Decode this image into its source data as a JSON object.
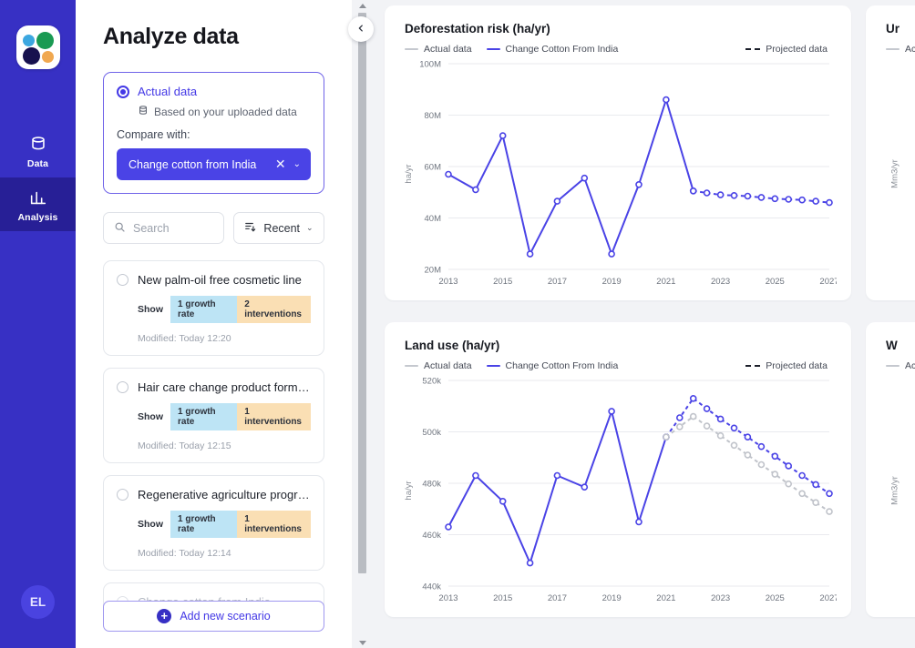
{
  "rail": {
    "logo_name": "app-logo",
    "items": [
      {
        "label": "Data",
        "icon": "database-icon"
      },
      {
        "label": "Analysis",
        "icon": "bar-chart-icon"
      }
    ],
    "avatar_initials": "EL"
  },
  "panel": {
    "title": "Analyze data",
    "source": {
      "radio_label": "Actual data",
      "sub_label": "Based on your uploaded data",
      "compare_label": "Compare with:",
      "pill_label": "Change cotton from India",
      "pill_clear": "✕",
      "pill_caret": "⌄"
    },
    "search_placeholder": "Search",
    "sort_label": "Recent",
    "sort_caret": "⌄",
    "show_label": "Show",
    "scenarios": [
      {
        "name": "New palm-oil free cosmetic line",
        "growth_tag": "1 growth rate",
        "intervention_tag": "2 interventions",
        "modified": "Modified: Today 12:20"
      },
      {
        "name": "Hair care change product formula",
        "growth_tag": "1 growth rate",
        "intervention_tag": "1 interventions",
        "modified": "Modified: Today 12:15"
      },
      {
        "name": "Regenerative agriculture progra...",
        "growth_tag": "1 growth rate",
        "intervention_tag": "1 interventions",
        "modified": "Modified: Today 12:14"
      },
      {
        "name": "Change cotton from India",
        "growth_tag": "",
        "intervention_tag": "",
        "modified": ""
      }
    ],
    "add_button": "Add new scenario",
    "add_icon": "plus-circle-icon"
  },
  "gutter": {
    "collapse_icon": "chevron-left-icon"
  },
  "charts": {
    "legend": {
      "actual": "Actual data",
      "scenario": "Change Cotton From India",
      "projected": "Projected data"
    },
    "partial": [
      {
        "title": "Ur",
        "ylabel": "Mm3/yr"
      },
      {
        "title": "W",
        "ylabel": "Mm3/yr"
      }
    ]
  },
  "chart_data": [
    {
      "type": "line",
      "title": "Deforestation risk (ha/yr)",
      "xlabel": "",
      "ylabel": "ha/yr",
      "ylim": [
        20000000,
        100000000
      ],
      "yticks": [
        20000000,
        40000000,
        60000000,
        80000000,
        100000000
      ],
      "ytick_labels": [
        "20M",
        "40M",
        "60M",
        "80M",
        "100M"
      ],
      "xlim": [
        2013,
        2027
      ],
      "xticks": [
        2013,
        2015,
        2017,
        2019,
        2021,
        2023,
        2025,
        2027
      ],
      "grid": true,
      "legend_position": "top",
      "series": [
        {
          "name": "Change Cotton From India",
          "style": "solid",
          "color": "#4a43e6",
          "x": [
            2013,
            2014,
            2015,
            2016,
            2017,
            2018,
            2019,
            2020,
            2021,
            2022
          ],
          "values": [
            57000000,
            51000000,
            72000000,
            26000000,
            46500000,
            55500000,
            26000000,
            53000000,
            86000000,
            50500000
          ]
        },
        {
          "name": "Projected data",
          "style": "dashed",
          "color": "#4a43e6",
          "x": [
            2022,
            2023,
            2024,
            2025,
            2026,
            2027
          ],
          "values": [
            50500000,
            49000000,
            48500000,
            47500000,
            47000000,
            46000000
          ]
        }
      ]
    },
    {
      "type": "line",
      "title": "Land use (ha/yr)",
      "xlabel": "",
      "ylabel": "ha/yr",
      "ylim": [
        440000,
        520000
      ],
      "yticks": [
        440000,
        460000,
        480000,
        500000,
        520000
      ],
      "ytick_labels": [
        "440k",
        "460k",
        "480k",
        "500k",
        "520k"
      ],
      "xlim": [
        2013,
        2027
      ],
      "xticks": [
        2013,
        2015,
        2017,
        2019,
        2021,
        2023,
        2025,
        2027
      ],
      "grid": true,
      "legend_position": "top",
      "series": [
        {
          "name": "Change Cotton From India",
          "style": "solid",
          "color": "#4a43e6",
          "x": [
            2013,
            2014,
            2015,
            2016,
            2017,
            2018,
            2019,
            2020,
            2021
          ],
          "values": [
            463000,
            483000,
            473000,
            449000,
            483000,
            478500,
            508000,
            465000,
            498000
          ]
        },
        {
          "name": "Change Cotton From India projected",
          "style": "dashed",
          "color": "#4a43e6",
          "x": [
            2021,
            2022,
            2023,
            2024,
            2025,
            2026,
            2027
          ],
          "values": [
            498000,
            513000,
            505000,
            498000,
            490500,
            483000,
            476000
          ]
        },
        {
          "name": "Actual data projected",
          "style": "dashed",
          "color": "#c0c3ca",
          "x": [
            2021,
            2022,
            2023,
            2024,
            2025,
            2026,
            2027
          ],
          "values": [
            498000,
            506000,
            498500,
            491000,
            483500,
            476000,
            469000
          ]
        }
      ]
    }
  ]
}
